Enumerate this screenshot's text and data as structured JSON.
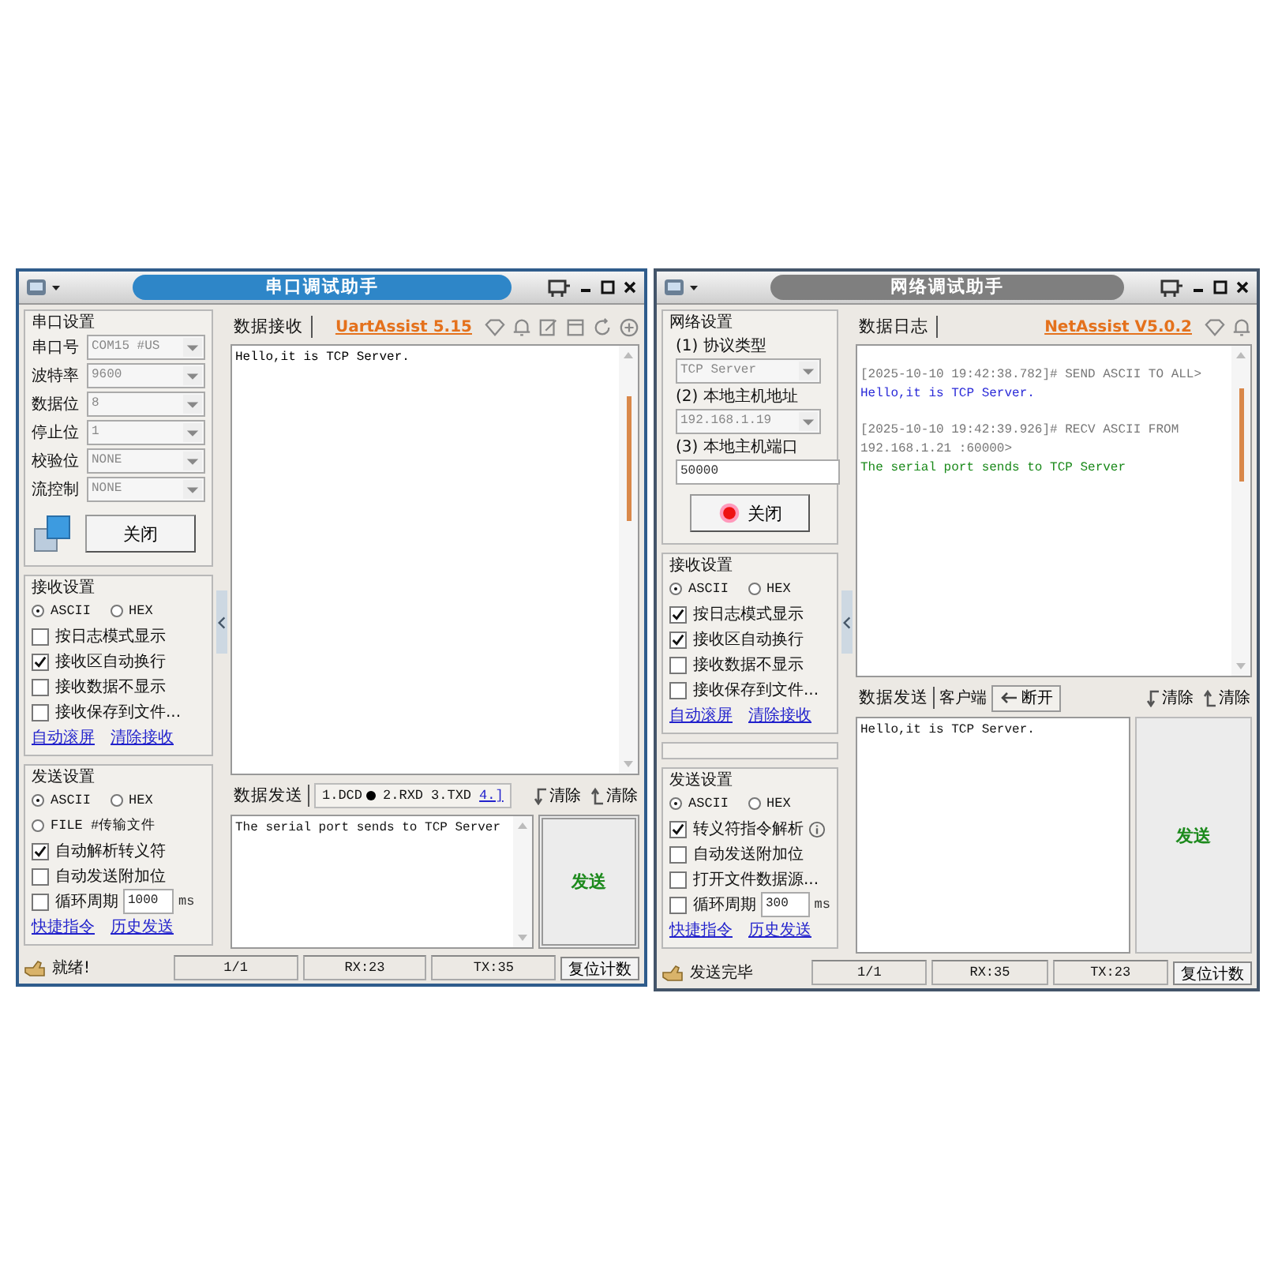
{
  "windows": [
    {
      "kind": "uart",
      "active": true,
      "title": "串口调试助手",
      "brand": "UartAssist 5.15",
      "settings": {
        "title": "串口设置",
        "kind": "serial",
        "fields": [
          {
            "label": "串口号",
            "value": "COM15 #US"
          },
          {
            "label": "波特率",
            "value": "9600"
          },
          {
            "label": "数据位",
            "value": "8"
          },
          {
            "label": "停止位",
            "value": "1"
          },
          {
            "label": "校验位",
            "value": "NONE"
          },
          {
            "label": "流控制",
            "value": "NONE"
          }
        ],
        "button": "关闭"
      },
      "receive": {
        "title": "接收设置",
        "modes": [
          {
            "label": "ASCII",
            "selected": true
          },
          {
            "label": "HEX",
            "selected": false
          }
        ],
        "options": [
          {
            "label": "按日志模式显示",
            "checked": false
          },
          {
            "label": "接收区自动换行",
            "checked": true
          },
          {
            "label": "接收数据不显示",
            "checked": false
          },
          {
            "label": "接收保存到文件...",
            "checked": false
          }
        ],
        "links": [
          "自动滚屏",
          "清除接收"
        ]
      },
      "send": {
        "title": "发送设置",
        "modes": [
          {
            "label": "ASCII",
            "selected": true
          },
          {
            "label": "HEX",
            "selected": false
          }
        ],
        "options": [
          {
            "kind": "radio",
            "label": "FILE #传输文件",
            "checked": false
          },
          {
            "kind": "check",
            "label": "自动解析转义符",
            "checked": true
          },
          {
            "kind": "check",
            "label": "自动发送附加位",
            "checked": false
          },
          {
            "kind": "cycle",
            "label": "循环周期",
            "checked": false,
            "value": "1000",
            "unit": "ms"
          }
        ],
        "links": [
          "快捷指令",
          "历史发送"
        ]
      },
      "log_tab": "数据接收",
      "log": [
        {
          "text": "Hello,it is TCP Server.",
          "color": "#000000"
        }
      ],
      "send_bar": {
        "tab": "数据发送",
        "kind": "signals",
        "signals": [
          {
            "label": "1.DCD",
            "on": true
          },
          {
            "label": "2.RXD",
            "on": false
          },
          {
            "label": "3.TXD",
            "on": false
          }
        ],
        "more": "4.]",
        "clear_buttons": [
          "清除",
          "清除"
        ]
      },
      "send_text": "The serial port sends to TCP Server",
      "send_button": "发送",
      "status": [
        "就绪!",
        "1/1",
        "RX:23",
        "TX:35"
      ],
      "reset_button": "复位计数"
    },
    {
      "kind": "net",
      "active": false,
      "title": "网络调试助手",
      "brand": "NetAssist V5.0.2",
      "settings": {
        "title": "网络设置",
        "kind": "net",
        "fields": [
          {
            "label": "(1) 协议类型",
            "value": "TCP Server",
            "kind": "select"
          },
          {
            "label": "(2) 本地主机地址",
            "value": "192.168.1.19",
            "kind": "select"
          },
          {
            "label": "(3) 本地主机端口",
            "value": "50000",
            "kind": "input"
          }
        ],
        "button": "关闭"
      },
      "receive": {
        "title": "接收设置",
        "modes": [
          {
            "label": "ASCII",
            "selected": true
          },
          {
            "label": "HEX",
            "selected": false
          }
        ],
        "options": [
          {
            "label": "按日志模式显示",
            "checked": true
          },
          {
            "label": "接收区自动换行",
            "checked": true
          },
          {
            "label": "接收数据不显示",
            "checked": false
          },
          {
            "label": "接收保存到文件...",
            "checked": false
          }
        ],
        "links": [
          "自动滚屏",
          "清除接收"
        ]
      },
      "send": {
        "title": "发送设置",
        "modes": [
          {
            "label": "ASCII",
            "selected": true
          },
          {
            "label": "HEX",
            "selected": false
          }
        ],
        "options": [
          {
            "kind": "info",
            "label": "转义符指令解析",
            "checked": true
          },
          {
            "kind": "check",
            "label": "自动发送附加位",
            "checked": false
          },
          {
            "kind": "check",
            "label": "打开文件数据源...",
            "checked": false
          },
          {
            "kind": "cycle",
            "label": "循环周期",
            "checked": false,
            "value": "300",
            "unit": "ms"
          }
        ],
        "links": [
          "快捷指令",
          "历史发送"
        ]
      },
      "log_tab": "数据日志",
      "log": [
        {
          "header": [
            "[2025-10-10 19:42:38.782]# SEND ASCII TO ALL>"
          ],
          "text": "Hello,it is TCP Server.",
          "color": "#2a2ad8"
        },
        {
          "header": [
            "[2025-10-10 19:42:39.926]# RECV ASCII FROM",
            "192.168.1.21 :60000>"
          ],
          "text": "The serial port sends to TCP Server",
          "color": "#1b8a1b"
        }
      ],
      "send_bar": {
        "tab": "数据发送",
        "kind": "clients",
        "client_label": "客户端",
        "disconnect": "断开",
        "clear_buttons": [
          "清除",
          "清除"
        ]
      },
      "send_text": "Hello,it is TCP Server.",
      "send_button": "发送",
      "status": [
        "发送完毕",
        "1/1",
        "RX:35",
        "TX:23"
      ],
      "reset_button": "复位计数"
    }
  ]
}
